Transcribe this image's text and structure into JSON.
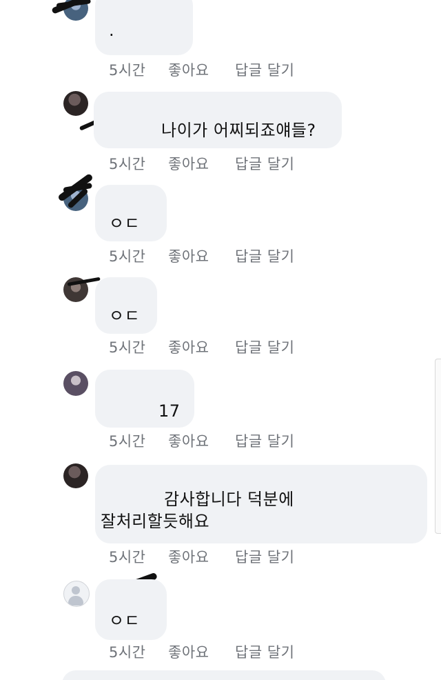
{
  "comments": [
    {
      "text": ".",
      "time": "5시간",
      "like": "좋아요",
      "reply": "답글 달기"
    },
    {
      "text": "나이가 어찌되죠얘들?",
      "time": "5시간",
      "like": "좋아요",
      "reply": "답글 달기"
    },
    {
      "text": "ㅇㄷ",
      "time": "5시간",
      "like": "좋아요",
      "reply": "답글 달기"
    },
    {
      "text": "ㅇㄷ",
      "time": "5시간",
      "like": "좋아요",
      "reply": "답글 달기"
    },
    {
      "text": "17",
      "time": "5시간",
      "like": "좋아요",
      "reply": "답글 달기"
    },
    {
      "text": "감사합니다 덕분에\n잘처리할듯해요",
      "time": "5시간",
      "like": "좋아요",
      "reply": "답글 달기"
    },
    {
      "text": "ㅇㄷ",
      "time": "5시간",
      "like": "좋아요",
      "reply": "답글 달기"
    }
  ]
}
